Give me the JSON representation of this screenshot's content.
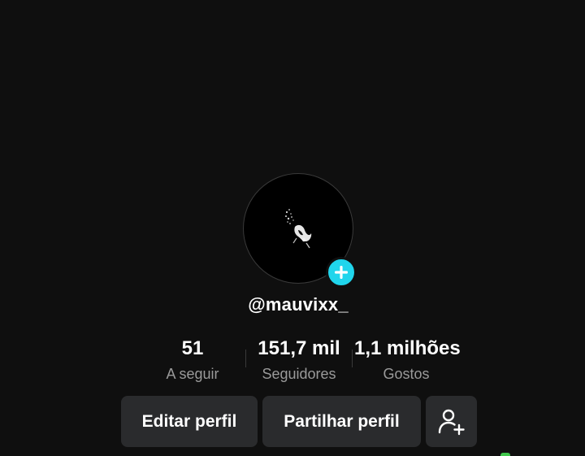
{
  "profile": {
    "username": "@mauvixx_",
    "avatar_icon": "falling-figure-artwork",
    "add_icon": "plus-icon",
    "accent_color": "#20d5ec"
  },
  "stats": [
    {
      "value": "51",
      "label": "A seguir"
    },
    {
      "value": "151,7 mil",
      "label": "Seguidores"
    },
    {
      "value": "1,1 milhões",
      "label": "Gostos"
    }
  ],
  "actions": {
    "edit_label": "Editar perfil",
    "share_label": "Partilhar perfil",
    "add_friend_icon": "add-user-icon"
  }
}
